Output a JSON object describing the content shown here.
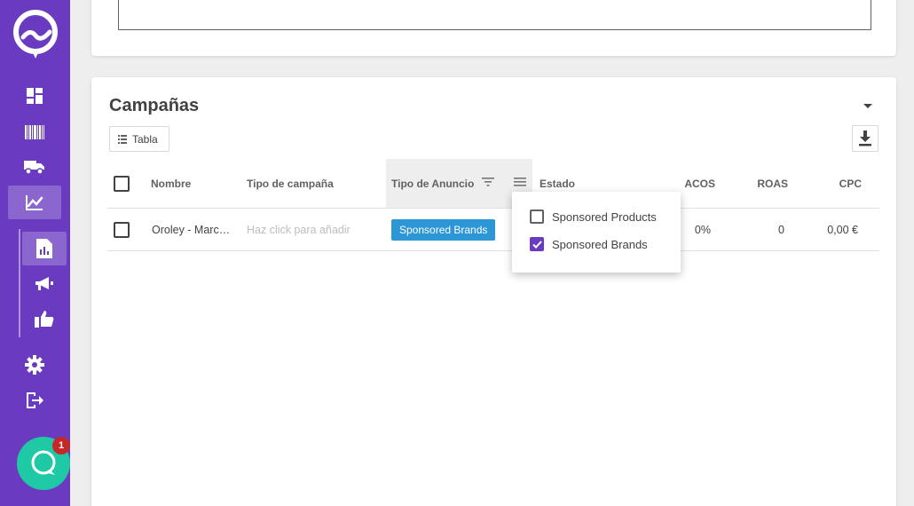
{
  "colors": {
    "sidebar": "#6a3bc0",
    "chat": "#1fc9a5",
    "badge": "#2d96d7",
    "notification": "#c62828"
  },
  "sidebar": {
    "icons": [
      "dashboard-icon",
      "barcode-icon",
      "truck-icon",
      "analytics-icon",
      "report-icon",
      "megaphone-icon",
      "thumbs-up-icon",
      "gear-icon",
      "logout-icon"
    ],
    "chat_badge_count": "1"
  },
  "campaigns": {
    "title": "Campañas",
    "view_button": "Tabla",
    "columns": {
      "name": "Nombre",
      "campaign_type": "Tipo de campaña",
      "ad_type": "Tipo de Anuncio",
      "status": "Estado",
      "acos": "ACOS",
      "roas": "ROAS",
      "cpc": "CPC"
    },
    "rows": [
      {
        "name": "Oroley - Marc…",
        "campaign_type": "Haz click para añadir",
        "ad_type": "Sponsored Brands",
        "acos": "0%",
        "roas": "0",
        "cpc": "0,00 €"
      }
    ]
  },
  "ad_type_filter": {
    "options": [
      {
        "label": "Sponsored Products",
        "checked": false
      },
      {
        "label": "Sponsored Brands",
        "checked": true
      }
    ]
  }
}
